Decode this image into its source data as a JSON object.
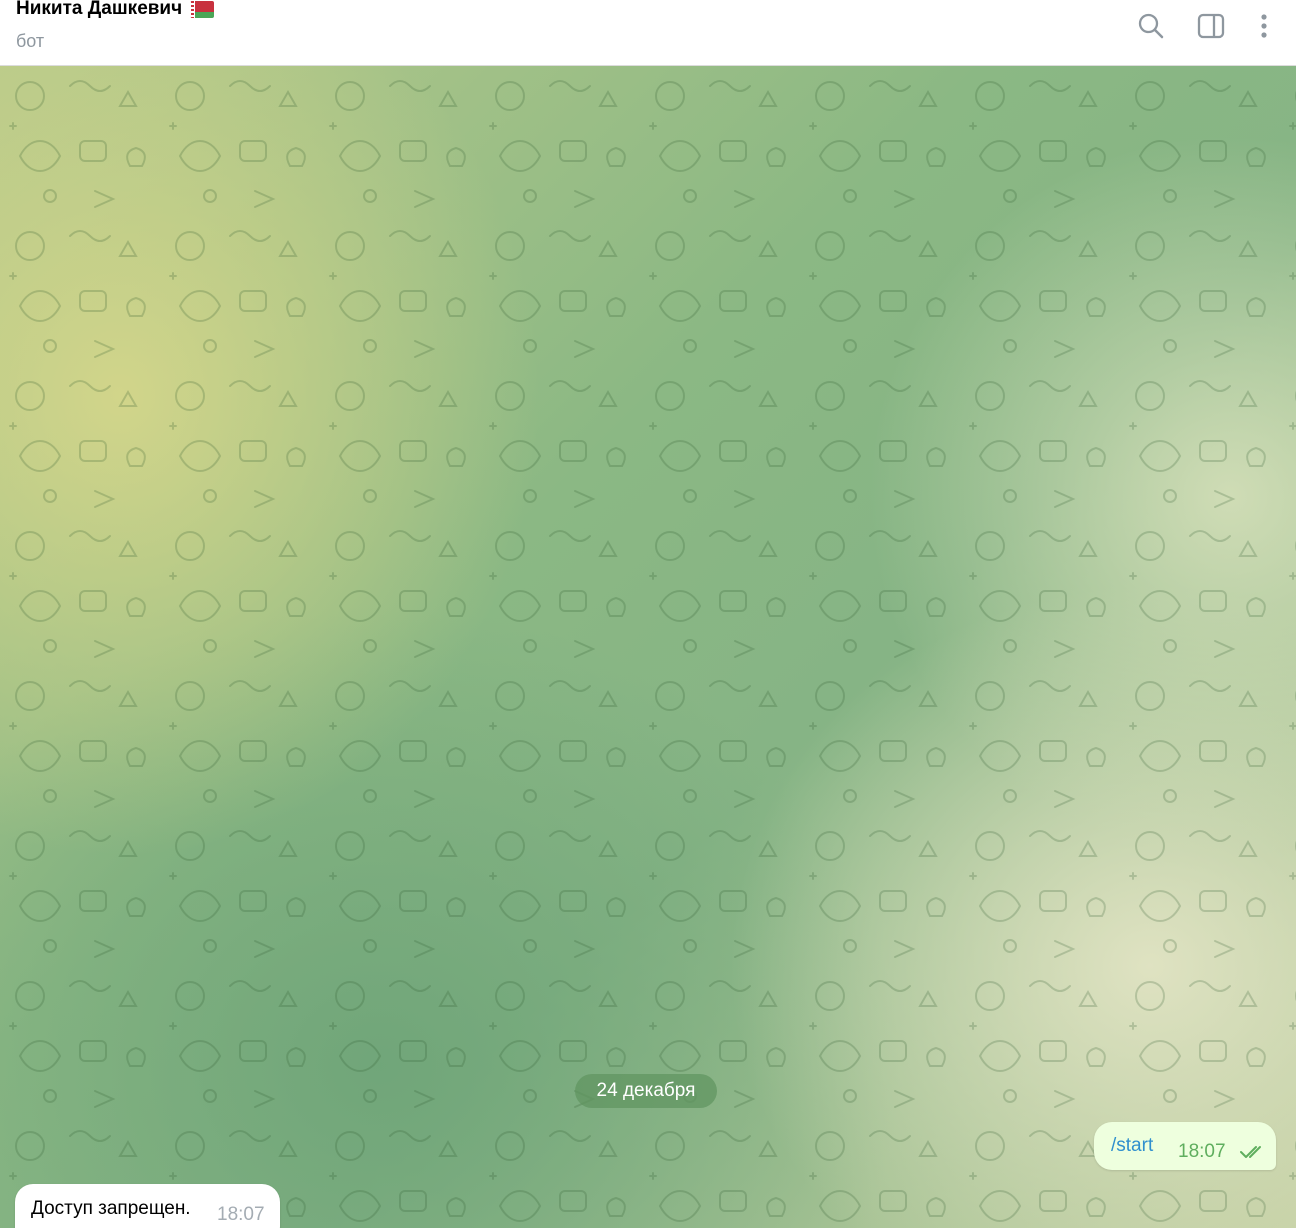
{
  "header": {
    "title": "Никита Дашкевич",
    "flag_icon": "belarus-flag-icon",
    "subtitle": "бот",
    "actions": [
      {
        "name": "search-button",
        "icon": "search-icon"
      },
      {
        "name": "sidebar-toggle-button",
        "icon": "sidebar-icon"
      },
      {
        "name": "more-menu-button",
        "icon": "more-vertical-icon"
      }
    ]
  },
  "chat": {
    "date_separator": "24 декабря",
    "messages": [
      {
        "direction": "outgoing",
        "text": "/start",
        "time": "18:07",
        "status": "read"
      },
      {
        "direction": "incoming",
        "text": "Доступ запрещен.",
        "time": "18:07"
      }
    ]
  },
  "colors": {
    "outgoing_bubble": "#eeffde",
    "incoming_bubble": "#ffffff",
    "link": "#2f8fce",
    "read_ticks": "#5fae5e",
    "date_pill": "#6a9c68"
  }
}
